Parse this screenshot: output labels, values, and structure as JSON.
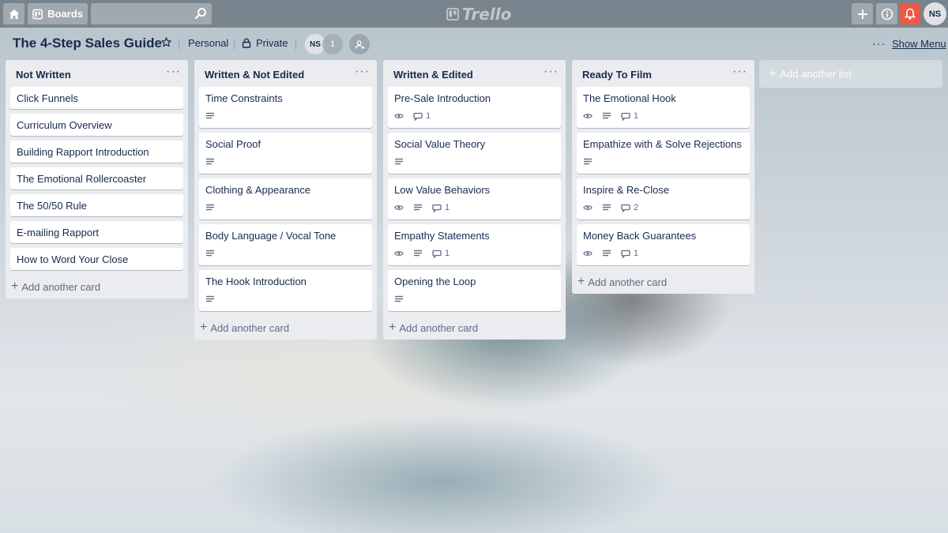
{
  "header": {
    "boards_label": "Boards",
    "search_placeholder": "",
    "logo_text": "Trello",
    "avatar_initials": "NS"
  },
  "board": {
    "title": "The 4-Step Sales Guide",
    "visibility_team": "Personal",
    "visibility_privacy": "Private",
    "member_initials": "NS",
    "member_count": "1",
    "show_menu": "Show Menu"
  },
  "lists": [
    {
      "title": "Not Written",
      "add_card": "Add another card",
      "cards": [
        {
          "title": "Click Funnels"
        },
        {
          "title": "Curriculum Overview"
        },
        {
          "title": "Building Rapport Introduction"
        },
        {
          "title": "The Emotional Rollercoaster"
        },
        {
          "title": "The 50/50 Rule"
        },
        {
          "title": "E-mailing Rapport"
        },
        {
          "title": "How to Word Your Close"
        }
      ]
    },
    {
      "title": "Written & Not Edited",
      "add_card": "Add another card",
      "cards": [
        {
          "title": "Time Constraints"
        },
        {
          "title": "Social Proof"
        },
        {
          "title": "Clothing & Appearance"
        },
        {
          "title": "Body Language / Vocal Tone"
        },
        {
          "title": "The Hook Introduction"
        }
      ]
    },
    {
      "title": "Written & Edited",
      "add_card": "Add another card",
      "cards": [
        {
          "title": "Pre-Sale Introduction",
          "comments": "1"
        },
        {
          "title": "Social Value Theory"
        },
        {
          "title": "Low Value Behaviors",
          "comments": "1"
        },
        {
          "title": "Empathy Statements",
          "comments": "1"
        },
        {
          "title": "Opening the Loop"
        }
      ]
    },
    {
      "title": "Ready To Film",
      "add_card": "Add another card",
      "cards": [
        {
          "title": "The Emotional Hook",
          "comments": "1"
        },
        {
          "title": "Empathize with & Solve Rejections"
        },
        {
          "title": "Inspire & Re-Close",
          "comments": "2"
        },
        {
          "title": "Money Back Guarantees",
          "comments": "1"
        }
      ]
    }
  ],
  "add_list_label": "Add another list",
  "colors": {
    "notification": "#eb5a46",
    "list_bg": "#ebecf0",
    "text": "#172b4d"
  }
}
